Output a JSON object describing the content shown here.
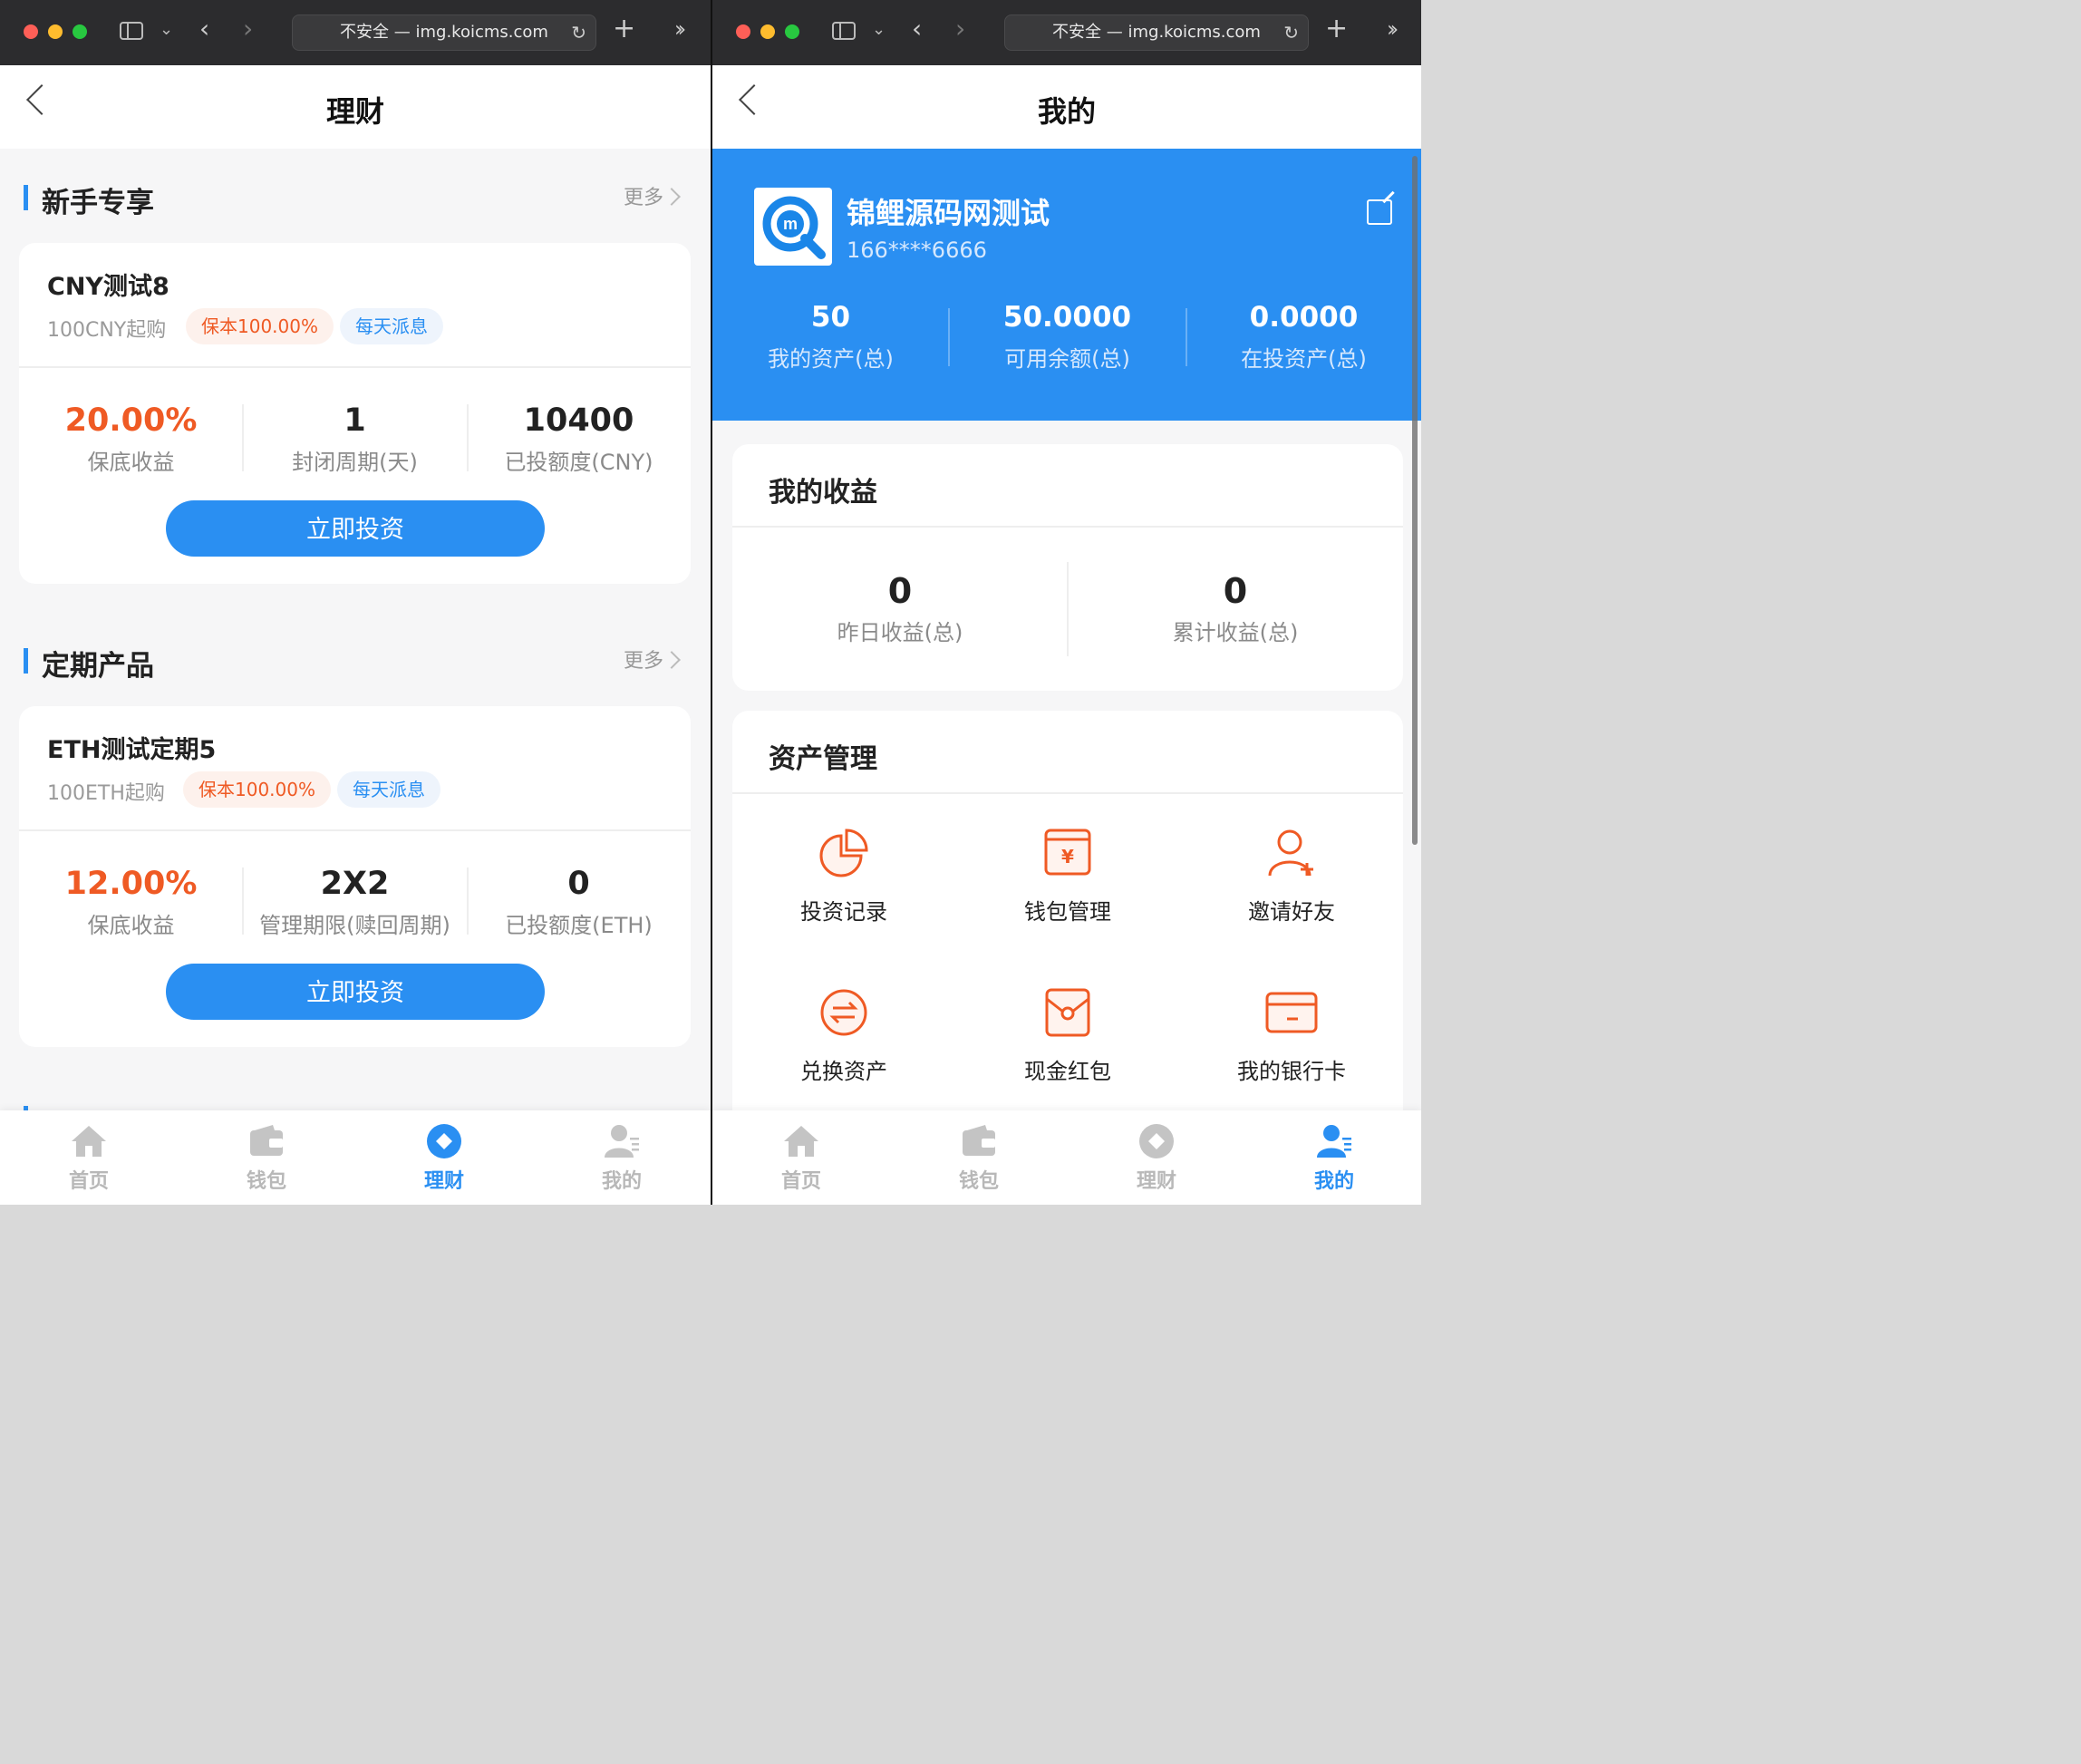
{
  "browser": {
    "url_text": "不安全 — img.koicms.com"
  },
  "left": {
    "header_title": "理财",
    "newbie": {
      "title": "新手专享",
      "more": "更多",
      "product": {
        "name": "CNY测试8",
        "min_buy": "100CNY起购",
        "tag_principal": "保本100.00%",
        "tag_interest": "每天派息",
        "rate": "20.00%",
        "rate_label": "保底收益",
        "period": "1",
        "period_label": "封闭周期(天)",
        "invested": "10400",
        "invested_label": "已投额度(CNY)",
        "button": "立即投资"
      }
    },
    "fixed": {
      "title": "定期产品",
      "more": "更多",
      "product": {
        "name": "ETH测试定期5",
        "min_buy": "100ETH起购",
        "tag_principal": "保本100.00%",
        "tag_interest": "每天派息",
        "rate": "12.00%",
        "rate_label": "保底收益",
        "period": "2X2",
        "period_label": "管理期限(赎回周期)",
        "invested": "0",
        "invested_label": "已投额度(ETH)",
        "button": "立即投资"
      }
    }
  },
  "right": {
    "header_title": "我的",
    "profile": {
      "name": "锦鲤源码网测试",
      "phone": "166****6666",
      "stats": [
        {
          "value": "50",
          "label": "我的资产(总)"
        },
        {
          "value": "50.0000",
          "label": "可用余额(总)"
        },
        {
          "value": "0.0000",
          "label": "在投资产(总)"
        }
      ]
    },
    "earnings": {
      "title": "我的收益",
      "items": [
        {
          "value": "0",
          "label": "昨日收益(总)"
        },
        {
          "value": "0",
          "label": "累计收益(总)"
        }
      ]
    },
    "assets": {
      "title": "资产管理",
      "items": [
        {
          "label": "投资记录",
          "icon": "pie-chart-icon"
        },
        {
          "label": "钱包管理",
          "icon": "yuan-wallet-icon"
        },
        {
          "label": "邀请好友",
          "icon": "add-user-icon"
        },
        {
          "label": "兑换资产",
          "icon": "exchange-icon"
        },
        {
          "label": "现金红包",
          "icon": "red-envelope-icon"
        },
        {
          "label": "我的银行卡",
          "icon": "bank-card-icon"
        }
      ]
    }
  },
  "tabs": [
    {
      "label": "首页",
      "icon": "home-icon"
    },
    {
      "label": "钱包",
      "icon": "wallet-icon"
    },
    {
      "label": "理财",
      "icon": "finance-icon"
    },
    {
      "label": "我的",
      "icon": "user-icon"
    }
  ],
  "colors": {
    "accent": "#2a8ff2",
    "highlight": "#ef5a24"
  }
}
